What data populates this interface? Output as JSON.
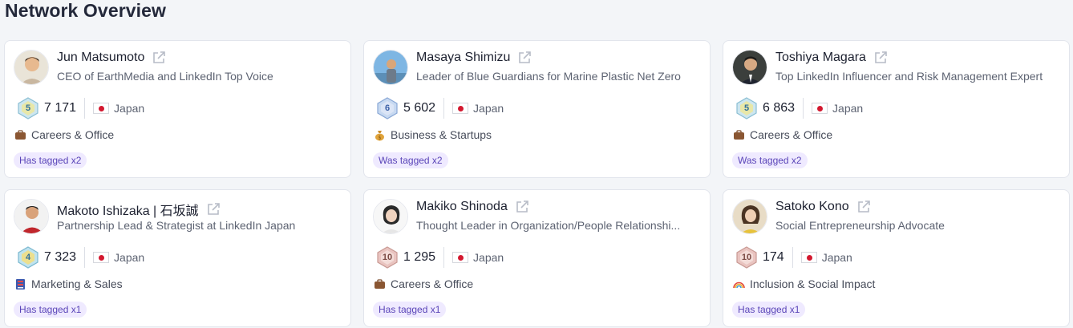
{
  "page": {
    "title": "Network Overview"
  },
  "colors": {
    "tag_bg": "#efeaff",
    "tag_text": "#5a45b8",
    "flag_red": "#d3182f"
  },
  "cards": [
    {
      "name": "Jun Matsumoto",
      "headline": "CEO of EarthMedia and LinkedIn Top Voice",
      "level": "5",
      "followers": "7 171",
      "country": "Japan",
      "category": "Careers & Office",
      "category_icon": "briefcase-icon",
      "tag": "Has tagged x2"
    },
    {
      "name": "Masaya Shimizu",
      "headline": "Leader of Blue Guardians for Marine Plastic Net Zero",
      "level": "6",
      "followers": "5 602",
      "country": "Japan",
      "category": "Business & Startups",
      "category_icon": "money-bag-icon",
      "tag": "Was tagged x2"
    },
    {
      "name": "Toshiya Magara",
      "headline": "Top LinkedIn Influencer and Risk Management Expert",
      "level": "5",
      "followers": "6 863",
      "country": "Japan",
      "category": "Careers & Office",
      "category_icon": "briefcase-icon",
      "tag": "Was tagged x2"
    },
    {
      "name": "Makoto Ishizaka | 石坂誠",
      "headline": "Partnership Lead & Strategist at LinkedIn Japan",
      "level": "4",
      "followers": "7 323",
      "country": "Japan",
      "category": "Marketing & Sales",
      "category_icon": "marketing-icon",
      "tag": "Has tagged x1"
    },
    {
      "name": "Makiko Shinoda",
      "headline": "Thought Leader in Organization/People Relationshi...",
      "level": "10",
      "followers": "1 295",
      "country": "Japan",
      "category": "Careers & Office",
      "category_icon": "briefcase-icon",
      "tag": "Has tagged x1"
    },
    {
      "name": "Satoko Kono",
      "headline": "Social Entrepreneurship Advocate",
      "level": "10",
      "followers": "174",
      "country": "Japan",
      "category": "Inclusion & Social Impact",
      "category_icon": "rainbow-icon",
      "tag": "Has tagged x1"
    }
  ]
}
